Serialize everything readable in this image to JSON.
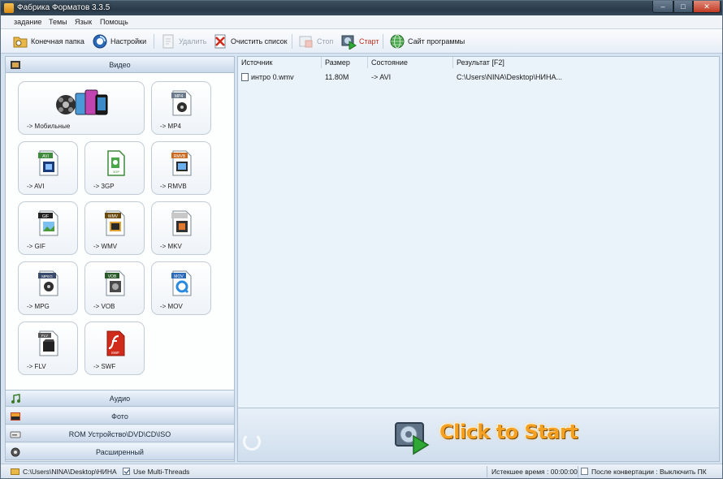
{
  "window": {
    "title": "Фабрика Форматов 3.3.5",
    "controls": {
      "minimize": "–",
      "maximize": "□",
      "close": "✕"
    }
  },
  "menu": [
    "задание",
    "Темы",
    "Язык",
    "Помощь"
  ],
  "toolbar": {
    "output_folder": "Конечная папка",
    "settings": "Настройки",
    "remove": "Удалить",
    "clear_list": "Очистить список",
    "stop": "Стоп",
    "start": "Старт",
    "website": "Сайт программы"
  },
  "sidebar": {
    "video_header": "Видео",
    "formats": [
      {
        "label": "-> Мобильные",
        "icon": "mobile-devices-icon"
      },
      {
        "label": "-> MP4",
        "icon": "mp4-file-icon",
        "badge": "MP4"
      },
      {
        "label": "-> AVI",
        "icon": "avi-file-icon",
        "badge": "AVI"
      },
      {
        "label": "-> 3GP",
        "icon": "3gp-file-icon",
        "badge": "3GP"
      },
      {
        "label": "-> RMVB",
        "icon": "rmvb-file-icon",
        "badge": "RMVB"
      },
      {
        "label": "-> GIF",
        "icon": "gif-file-icon",
        "badge": "GIF"
      },
      {
        "label": "-> WMV",
        "icon": "wmv-file-icon",
        "badge": "WMV"
      },
      {
        "label": "-> MKV",
        "icon": "mkv-file-icon",
        "badge": ""
      },
      {
        "label": "-> MPG",
        "icon": "mpg-file-icon",
        "badge": "MPEG"
      },
      {
        "label": "-> VOB",
        "icon": "vob-file-icon",
        "badge": "VOB"
      },
      {
        "label": "-> MOV",
        "icon": "mov-file-icon",
        "badge": "MOV"
      },
      {
        "label": "-> FLV",
        "icon": "flv-file-icon",
        "badge": "FLV"
      },
      {
        "label": "-> SWF",
        "icon": "swf-file-icon",
        "badge": "SWF"
      }
    ],
    "audio_header": "Аудио",
    "photo_header": "Фото",
    "rom_header": "ROM Устройство\\DVD\\CD\\ISO",
    "advanced_header": "Расширенный"
  },
  "file_list": {
    "columns": [
      "Источник",
      "Размер",
      "Состояние",
      "Результат [F2]"
    ],
    "rows": [
      {
        "source": "интро 0.wmv",
        "size": "11.80M",
        "state": "-> AVI",
        "result": "C:\\Users\\NINA\\Desktop\\НИНА..."
      }
    ]
  },
  "start_banner": "Click to Start",
  "status": {
    "output_path": "C:\\Users\\NINA\\Desktop\\НИНА",
    "multithreads": "Use Multi-Threads",
    "elapsed": "Истекшее время : 00:00:00",
    "after_convert": "После конвертации : Выключить ПК"
  },
  "colors": {
    "accent_orange": "#f5a020",
    "panel_bg": "#e9f0f8",
    "header_blue": "#c9d8ea",
    "list_bg": "#eaf2fa"
  }
}
